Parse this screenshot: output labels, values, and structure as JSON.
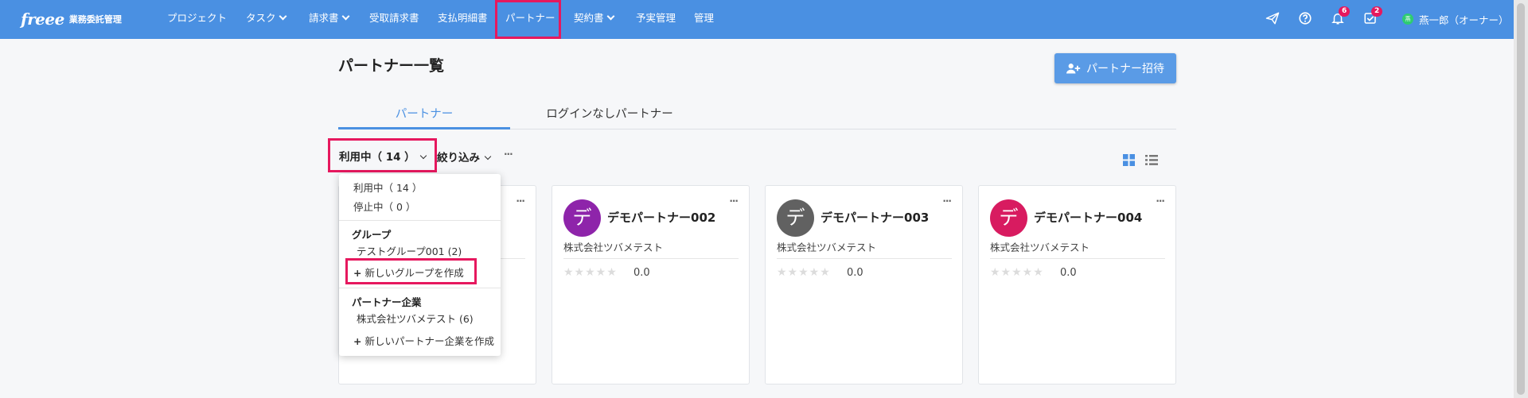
{
  "app": {
    "logo": "freee",
    "logo_sub": "業務委託管理"
  },
  "nav": {
    "items": [
      {
        "label": "プロジェクト"
      },
      {
        "label": "タスク"
      },
      {
        "label": "請求書"
      },
      {
        "label": "受取請求書"
      },
      {
        "label": "支払明細書"
      },
      {
        "label": "パートナー"
      },
      {
        "label": "契約書"
      },
      {
        "label": "予実管理"
      },
      {
        "label": "管理"
      }
    ],
    "notifications_count": "6",
    "tasks_count": "2",
    "user_initial": "燕",
    "user_name": "燕一郎（オーナー）"
  },
  "page": {
    "title": "パートナー一覧",
    "invite_button": "パートナー招待"
  },
  "tabs": [
    {
      "label": "パートナー",
      "active": true
    },
    {
      "label": "ログインなしパートナー",
      "active": false
    }
  ],
  "filters": {
    "status": "利用中（ 14 ）",
    "narrow": "絞り込み",
    "more": "···"
  },
  "dropdown": {
    "status_items": [
      "利用中（ 14 ）",
      "停止中（ 0 ）"
    ],
    "group_heading": "グループ",
    "group_items": [
      "テストグループ001 (2)"
    ],
    "new_group": "新しいグループを作成",
    "company_heading": "パートナー企業",
    "company_items": [
      "株式会社ツバメテスト (6)"
    ],
    "new_company": "新しいパートナー企業を作成"
  },
  "cards": [
    {
      "initial": "デ",
      "name": "デモパートナー002",
      "company": "株式会社ツバメテスト",
      "rating": "0.0",
      "color": "#8e24aa"
    },
    {
      "initial": "デ",
      "name": "デモパートナー003",
      "company": "株式会社ツバメテスト",
      "rating": "0.0",
      "color": "#616161"
    },
    {
      "initial": "デ",
      "name": "デモパートナー004",
      "company": "株式会社ツバメテスト",
      "rating": "0.0",
      "color": "#d81b60"
    }
  ],
  "colors": {
    "brand": "#4a90e2",
    "highlight": "#e6185e"
  },
  "icons": {
    "send": "paper-plane-icon",
    "help": "question-circle-icon",
    "notifications": "bell-icon",
    "tasks": "checkbox-icon",
    "invite": "user-plus-icon",
    "grid_view": "grid-icon",
    "list_view": "list-icon"
  }
}
